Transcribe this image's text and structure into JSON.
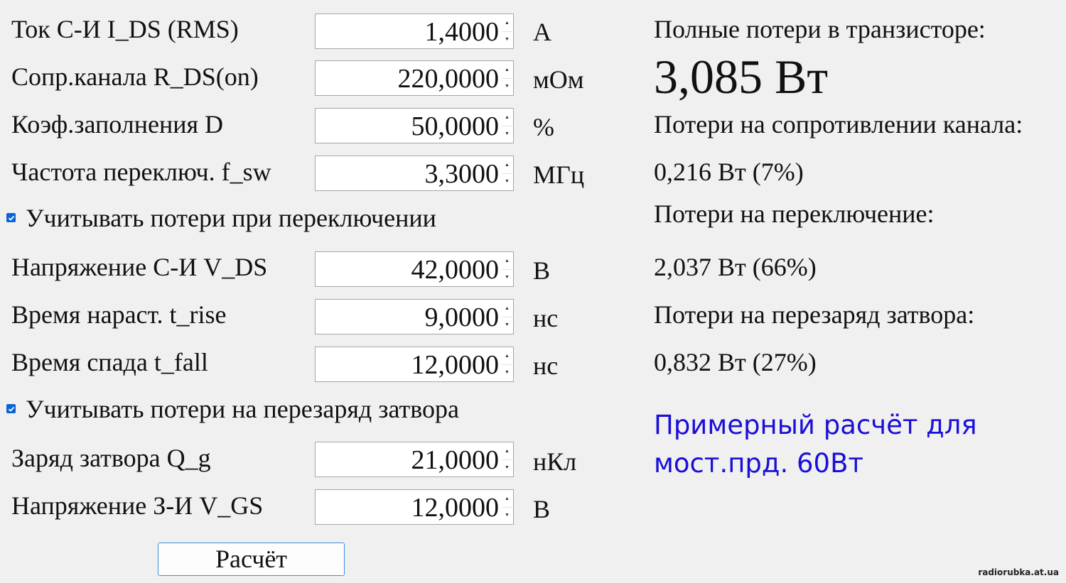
{
  "inputs": [
    {
      "label": "Ток С-И I_DS (RMS)",
      "value": "1,4000",
      "unit": "А"
    },
    {
      "label": "Сопр.канала R_DS(on)",
      "value": "220,0000",
      "unit": "мОм"
    },
    {
      "label": "Коэф.заполнения  D",
      "value": "50,0000",
      "unit": "%"
    },
    {
      "label": "Частота переключ. f_sw",
      "value": "3,3000",
      "unit": "МГц"
    },
    {
      "label": "Напряжение С-И V_DS",
      "value": "42,0000",
      "unit": "В"
    },
    {
      "label": "Время нараст. t_rise",
      "value": "9,0000",
      "unit": "нс"
    },
    {
      "label": "Время спада t_fall",
      "value": "12,0000",
      "unit": "нс"
    },
    {
      "label": "Заряд затвора Q_g",
      "value": "21,0000",
      "unit": "нКл"
    },
    {
      "label": "Напряжение З-И V_GS",
      "value": "12,0000",
      "unit": "В"
    }
  ],
  "checkboxes": {
    "switching_losses": {
      "label": "Учитывать потери при переключении",
      "checked": true
    },
    "gate_losses": {
      "label": "Учитывать потери на перезаряд затвора",
      "checked": true
    }
  },
  "results": {
    "total_label": "Полные потери в транзисторе:",
    "total_value": "3,085 Вт",
    "conduction_label": "Потери на сопротивлении канала:",
    "conduction_value": "0,216 Вт (7%)",
    "switching_label": "Потери на переключение:",
    "switching_value": "2,037 Вт (66%)",
    "gate_label": "Потери на перезаряд затвора:",
    "gate_value": "0,832 Вт (27%)"
  },
  "note": {
    "line1": "Примерный расчёт для",
    "line2": "мост.прд. 60Вт"
  },
  "calc_button": "Расчёт",
  "watermark": "radiorubka.at.ua",
  "colors": {
    "note": "#1a0fd8",
    "checkbox": "#0a64d6",
    "button_border": "#3c8fe0"
  }
}
